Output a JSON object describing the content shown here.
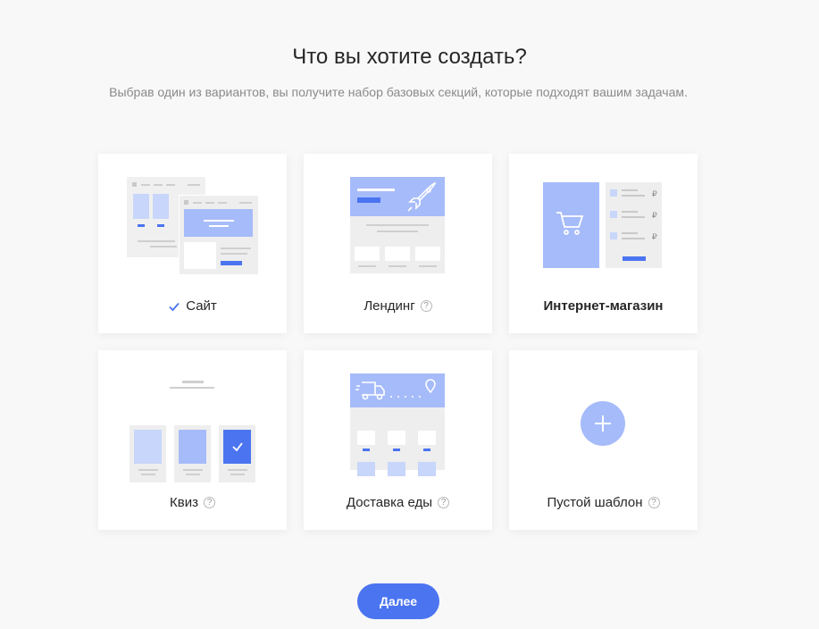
{
  "header": {
    "title": "Что вы хотите создать?",
    "subtitle": "Выбрав один из вариантов, вы получите набор базовых секций, которые подходят вашим задачам."
  },
  "cards": [
    {
      "label": "Сайт",
      "selected": true,
      "help": false
    },
    {
      "label": "Лендинг",
      "selected": false,
      "help": true
    },
    {
      "label": "Интернет-магазин",
      "selected": false,
      "help": false
    },
    {
      "label": "Квиз",
      "selected": false,
      "help": true
    },
    {
      "label": "Доставка еды",
      "selected": false,
      "help": true
    },
    {
      "label": "Пустой шаблон",
      "selected": false,
      "help": true
    }
  ],
  "help_glyph": "?",
  "footer": {
    "next_label": "Далее"
  },
  "colors": {
    "accent": "#4b74f0",
    "illustration_blue": "#a6bbf9",
    "illustration_gray": "#eeeeee",
    "background": "#f8f8f8"
  }
}
